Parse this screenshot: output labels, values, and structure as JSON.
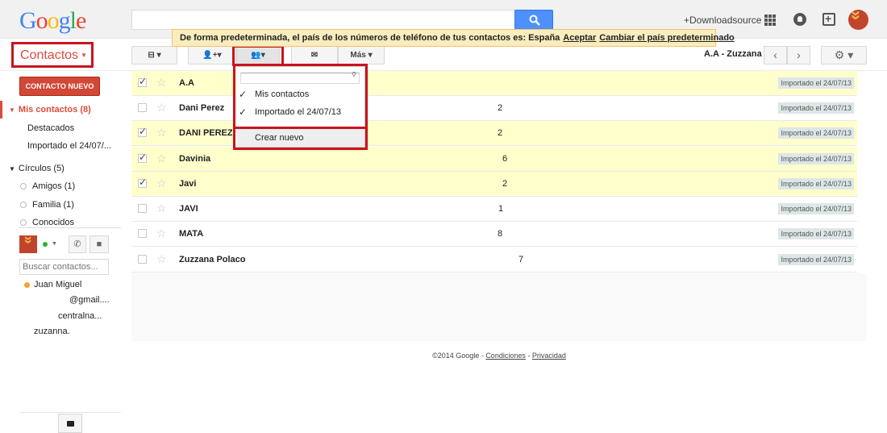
{
  "header": {
    "logo_letters": [
      "G",
      "o",
      "o",
      "g",
      "l",
      "e"
    ],
    "account_name": "+Downloadsource"
  },
  "toolbar": {
    "app_title": "Contactos",
    "more_label": "Más",
    "range": "A.A - Zuzzana"
  },
  "notice": {
    "text": "De forma predeterminada, el país de los números de teléfono de tus contactos es: España",
    "accept": "Aceptar",
    "change": "Cambiar el país predeterminado"
  },
  "sidebar": {
    "new_contact": "CONTACTO NUEVO",
    "my_contacts": "Mis contactos (8)",
    "starred": "Destacados",
    "imported": "Importado el 24/07/...",
    "circles": "Círculos (5)",
    "circle_items": [
      "Amigos (1)",
      "Familia (1)",
      "Conocidos"
    ],
    "chat_search_placeholder": "Buscar contactos...",
    "chat_contacts": [
      "Juan Miguel",
      "@gmail....",
      "centralna...",
      "zuzanna."
    ]
  },
  "contacts": [
    {
      "name": "A.A",
      "value": "",
      "tag": "Importado el 24/07/13",
      "selected": true
    },
    {
      "name": "Dani Perez",
      "value": "2",
      "tag": "Importado el 24/07/13",
      "selected": false
    },
    {
      "name": "DANI PEREZ",
      "value": "2",
      "tag": "Importado el 24/07/13",
      "selected": true
    },
    {
      "name": "Davinia",
      "value": "6",
      "tag": "Importado el 24/07/13",
      "selected": true
    },
    {
      "name": "Javi",
      "value": "2",
      "tag": "Importado el 24/07/13",
      "selected": true
    },
    {
      "name": "JAVI",
      "value": "1",
      "tag": "Importado el 24/07/13",
      "selected": false
    },
    {
      "name": "MATA",
      "value": "8",
      "tag": "Importado el 24/07/13",
      "selected": false
    },
    {
      "name": "Zuzzana Polaco",
      "value": "7",
      "tag": "Importado el 24/07/13",
      "selected": false
    }
  ],
  "groups_dropdown": {
    "items": [
      "Mis contactos",
      "Importado el 24/07/13"
    ],
    "create_new": "Crear nuevo"
  },
  "footer": {
    "copyright": "©2014 Google",
    "terms": "Condiciones",
    "privacy": "Privacidad"
  },
  "colors": {
    "accent_red": "#dd4b39",
    "annotation_red": "#c8141e",
    "selected_row": "#ffffcc",
    "notice_bg": "#f9edbe",
    "search_blue": "#4d90fe"
  }
}
